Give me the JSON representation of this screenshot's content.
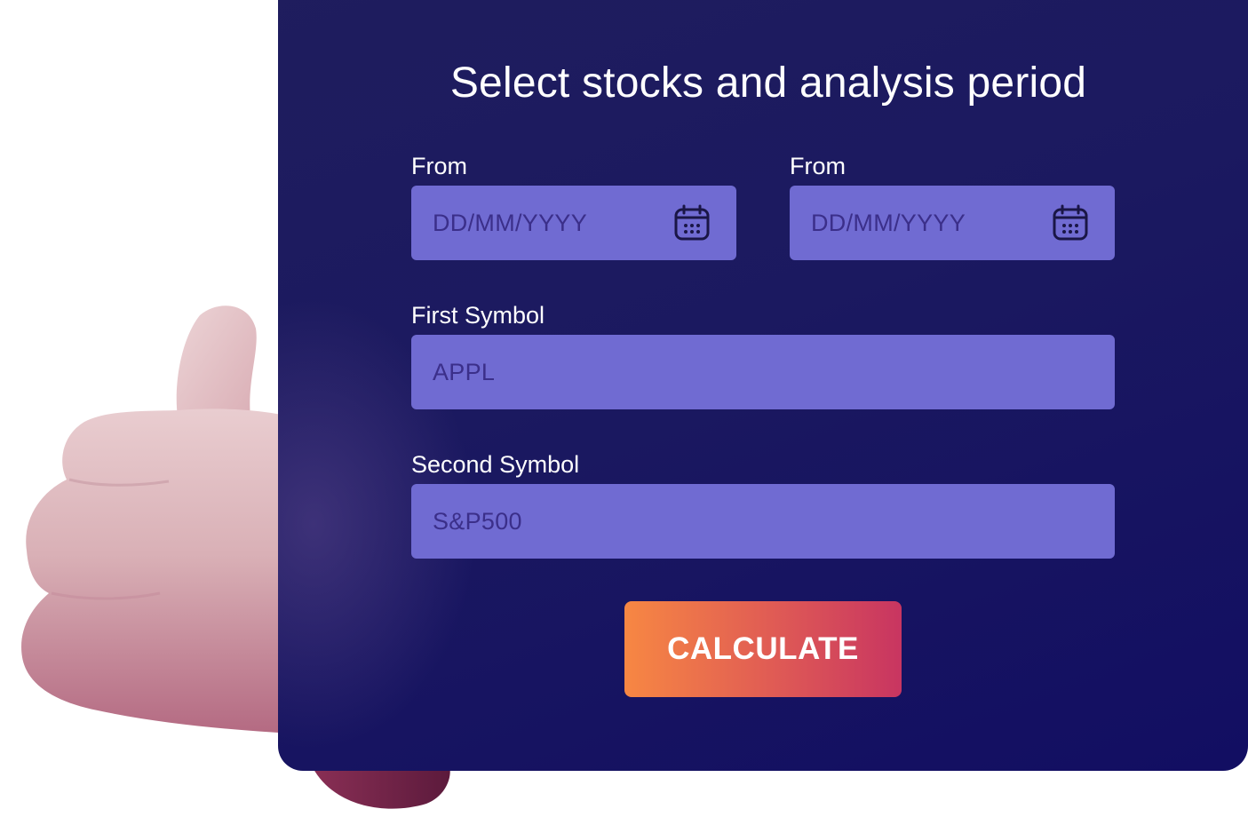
{
  "form": {
    "title": "Select stocks and analysis period",
    "from_date": {
      "label": "From",
      "placeholder": "DD/MM/YYYY",
      "icon": "calendar-icon"
    },
    "to_date": {
      "label": "From",
      "placeholder": "DD/MM/YYYY",
      "icon": "calendar-icon"
    },
    "first_symbol": {
      "label": "First Symbol",
      "placeholder": "APPL"
    },
    "second_symbol": {
      "label": "Second Symbol",
      "placeholder": "S&P500"
    },
    "submit_label": "CALCULATE"
  },
  "colors": {
    "card_background": "#1b1960",
    "input_background": "#706bd2",
    "placeholder_text": "#3b2f8a",
    "button_gradient_start": "#f78743",
    "button_gradient_end": "#c83561"
  }
}
